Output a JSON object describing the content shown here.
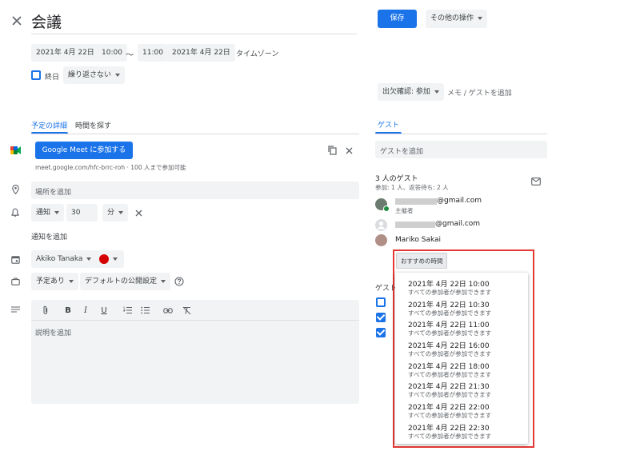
{
  "header": {
    "title": "会議",
    "save_label": "保存",
    "more_actions_label": "その他の操作"
  },
  "datetime": {
    "start_date": "2021年 4月 22日",
    "start_time": "10:00",
    "separator": "〜",
    "end_time": "11:00",
    "end_date": "2021年 4月 22日",
    "timezone_label": "タイムゾーン",
    "all_day_label": "終日",
    "repeat_label": "繰り返さない"
  },
  "tabs": {
    "details_label": "予定の詳細",
    "find_time_label": "時間を探す"
  },
  "meet": {
    "join_label": "Google Meet に参加する",
    "info": "meet.google.com/hfc-brrc-roh · 100 人まで参加可能"
  },
  "location": {
    "placeholder": "場所を追加"
  },
  "notification": {
    "type": "通知",
    "amount": "30",
    "unit": "分",
    "add_label": "通知を追加"
  },
  "owner": {
    "name": "Akiko Tanaka",
    "color": "#d50000"
  },
  "availability": {
    "status": "予定あり",
    "visibility": "デフォルトの公開設定"
  },
  "description": {
    "placeholder": "説明を追加",
    "toolbar": [
      "attach-icon",
      "bold-icon",
      "italic-icon",
      "underline-icon",
      "numbered-list-icon",
      "bulleted-list-icon",
      "link-icon",
      "clear-format-icon"
    ]
  },
  "rsvp": {
    "label": "出欠確認: 参加",
    "note_label": "メモ / ゲストを追加"
  },
  "guests": {
    "tab_label": "ゲスト",
    "add_placeholder": "ゲストを追加",
    "count_label": "3 人のゲスト",
    "summary": "参加: 1 人、返答待ち: 2 人",
    "list": [
      {
        "email": "@gmail.com",
        "role": "主催者"
      },
      {
        "email": "@gmail.com",
        "role": ""
      },
      {
        "email": "Mariko Sakai",
        "role": ""
      }
    ],
    "suggest_button": "おすすめの時間",
    "permissions_label": "ゲスト"
  },
  "suggestions": [
    {
      "time": "2021年 4月 22日 10:00",
      "note": "すべての参加者が参加できます"
    },
    {
      "time": "2021年 4月 22日 10:30",
      "note": "すべての参加者が参加できます"
    },
    {
      "time": "2021年 4月 22日 11:00",
      "note": "すべての参加者が参加できます"
    },
    {
      "time": "2021年 4月 22日 16:00",
      "note": "すべての参加者が参加できます"
    },
    {
      "time": "2021年 4月 22日 18:00",
      "note": "すべての参加者が参加できます"
    },
    {
      "time": "2021年 4月 22日 21:30",
      "note": "すべての参加者が参加できます"
    },
    {
      "time": "2021年 4月 22日 22:00",
      "note": "すべての参加者が参加できます"
    },
    {
      "time": "2021年 4月 22日 22:30",
      "note": "すべての参加者が参加できます"
    }
  ],
  "colors": {
    "accent": "#1a73e8",
    "highlight_border": "#e53935"
  }
}
